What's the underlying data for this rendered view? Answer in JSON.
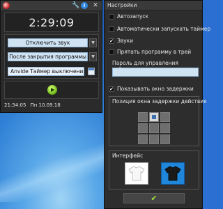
{
  "timer": {
    "time": "2:29:09",
    "sound_option": "Отключить звук",
    "action_option": "После закрытия программы",
    "task_name": "Anvide Таймер выключения",
    "status_time": "21:34:05",
    "status_date": "Пн 10.09.18"
  },
  "settings": {
    "title": "Настройки",
    "options": [
      {
        "label": "Автозапуск",
        "checked": false
      },
      {
        "label": "Автоматически запускать таймер",
        "checked": false
      },
      {
        "label": "Звуки",
        "checked": true
      },
      {
        "label": "Прятать программу в трей",
        "checked": false
      }
    ],
    "password_label": "Пароль для управления таймером",
    "password_value": "",
    "show_delay_window": {
      "label": "Показывать окно задержки",
      "checked": true
    },
    "delay_position_title": "Позиция окна задержки действия",
    "interface_title": "Интерфейс",
    "ok_symbol": "✔"
  },
  "colors": {
    "accent_blue": "#1f86d9",
    "play_green": "#7bc120",
    "field_bg": "#cfe3f3"
  }
}
